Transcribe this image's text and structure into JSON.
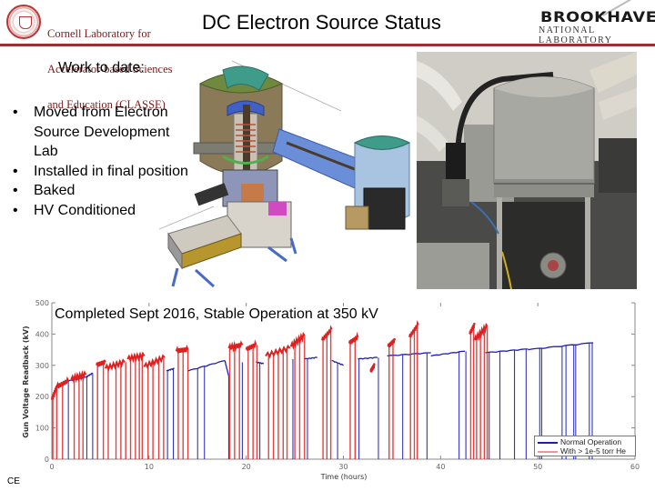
{
  "header": {
    "left_logo": {
      "text_lines": [
        "Cornell Laboratory for",
        "Accelerator-based Sciences",
        "and Education (CLASSE)"
      ],
      "icon": "cornell-seal-icon"
    },
    "title": "DC Electron Source Status",
    "right_logo": {
      "name": "BROOKHAVEN",
      "subtitle": "NATIONAL LABORATORY"
    },
    "rule_color": "#9b2f33"
  },
  "left_panel": {
    "heading": "Work to date:",
    "bullet_glyph": "•",
    "bullets": [
      "Moved from Electron Source Development Lab",
      "Installed in final position",
      "Baked",
      "HV Conditioned"
    ]
  },
  "images": {
    "cad_model": "dc-gun-cad-cutaway",
    "photo": "installed-gun-photo"
  },
  "footer_tag": "CE",
  "chart_caption": "Completed Sept 2016, Stable Operation at 350 kV",
  "chart_data": {
    "type": "line",
    "title": "",
    "xlabel": "Time (hours)",
    "ylabel": "Gun Voltage Readback (kV)",
    "xlim": [
      0,
      60
    ],
    "ylim": [
      0,
      500
    ],
    "xticks": [
      0,
      10,
      20,
      30,
      40,
      50,
      60
    ],
    "yticks": [
      0,
      100,
      200,
      300,
      400,
      500
    ],
    "grid": false,
    "legend_position": "bottom-right",
    "series": [
      {
        "name": "Normal Operation",
        "color": "#1f1fb4",
        "segments": [
          {
            "x": [
              1.7,
              3.5
            ],
            "y": [
              250,
              262
            ]
          },
          {
            "x": [
              3.5,
              4.2
            ],
            "y": [
              262,
              275
            ]
          },
          {
            "x": [
              11.8,
              12.6
            ],
            "y": [
              282,
              290
            ]
          },
          {
            "x": [
              14.0,
              17.8
            ],
            "y": [
              282,
              315
            ]
          },
          {
            "x": [
              17.8,
              18.2
            ],
            "y": [
              315,
              265
            ]
          },
          {
            "x": [
              21.0,
              21.8
            ],
            "y": [
              310,
              305
            ]
          },
          {
            "x": [
              26.0,
              27.3
            ],
            "y": [
              320,
              325
            ]
          },
          {
            "x": [
              28.8,
              30.0
            ],
            "y": [
              315,
              300
            ]
          },
          {
            "x": [
              31.5,
              33.5
            ],
            "y": [
              320,
              325
            ]
          },
          {
            "x": [
              34.5,
              39.0
            ],
            "y": [
              330,
              340
            ]
          },
          {
            "x": [
              39.0,
              42.5
            ],
            "y": [
              330,
              345
            ]
          },
          {
            "x": [
              44.6,
              49.0
            ],
            "y": [
              340,
              352
            ]
          },
          {
            "x": [
              49.0,
              55.7
            ],
            "y": [
              350,
              372
            ]
          }
        ],
        "drops_to_zero_at": [
          1.7,
          3.6,
          4.2,
          11.9,
          12.5,
          15.0,
          15.7,
          18.2,
          19.6,
          21.4,
          24.8,
          26.3,
          29.4,
          31.6,
          33.6,
          36.1,
          38.6,
          41.9,
          42.6,
          45.0,
          46.1,
          47.6,
          48.8,
          50.2,
          50.4,
          52.5,
          52.9,
          53.7,
          53.9,
          55.3,
          55.6
        ]
      },
      {
        "name": "With > 1e-5 torr He",
        "color": "#e02020",
        "segments": [
          {
            "x": [
              0.0,
              0.5
            ],
            "y": [
              190,
              230
            ]
          },
          {
            "x": [
              0.5,
              1.7
            ],
            "y": [
              230,
              250
            ]
          },
          {
            "x": [
              2.0,
              3.5
            ],
            "y": [
              255,
              270
            ]
          },
          {
            "x": [
              4.6,
              5.5
            ],
            "y": [
              300,
              310
            ]
          },
          {
            "x": [
              5.5,
              7.5
            ],
            "y": [
              290,
              310
            ]
          },
          {
            "x": [
              7.8,
              9.5
            ],
            "y": [
              320,
              330
            ]
          },
          {
            "x": [
              9.5,
              11.6
            ],
            "y": [
              295,
              325
            ]
          },
          {
            "x": [
              12.8,
              14.0
            ],
            "y": [
              345,
              350
            ]
          },
          {
            "x": [
              18.2,
              19.6
            ],
            "y": [
              355,
              365
            ]
          },
          {
            "x": [
              20.0,
              21.0
            ],
            "y": [
              350,
              365
            ]
          },
          {
            "x": [
              22.0,
              24.5
            ],
            "y": [
              330,
              355
            ]
          },
          {
            "x": [
              24.6,
              26.0
            ],
            "y": [
              360,
              395
            ]
          },
          {
            "x": [
              27.8,
              28.8
            ],
            "y": [
              380,
              415
            ]
          },
          {
            "x": [
              30.6,
              31.5
            ],
            "y": [
              370,
              390
            ]
          },
          {
            "x": [
              32.8,
              33.2
            ],
            "y": [
              280,
              300
            ]
          },
          {
            "x": [
              34.6,
              35.3
            ],
            "y": [
              360,
              380
            ]
          },
          {
            "x": [
              36.8,
              37.7
            ],
            "y": [
              390,
              430
            ]
          },
          {
            "x": [
              43.0,
              43.5
            ],
            "y": [
              400,
              430
            ]
          },
          {
            "x": [
              43.5,
              44.8
            ],
            "y": [
              380,
              425
            ]
          }
        ],
        "drops_to_zero_at": [
          0.1,
          0.5,
          1.1,
          2.3,
          2.8,
          3.2,
          4.7,
          5.3,
          5.8,
          6.6,
          7.1,
          7.6,
          8.1,
          8.6,
          9.0,
          9.3,
          9.9,
          10.4,
          11.0,
          11.5,
          13.0,
          13.5,
          14.0,
          18.3,
          18.8,
          19.3,
          20.2,
          20.7,
          21.1,
          22.3,
          22.8,
          23.3,
          23.8,
          24.2,
          25.0,
          25.5,
          26.0,
          27.9,
          28.3,
          28.7,
          30.7,
          31.2,
          34.7,
          35.1,
          36.9,
          37.3,
          37.6,
          43.1,
          43.4,
          43.7,
          44.1,
          44.5,
          44.8
        ]
      }
    ]
  }
}
